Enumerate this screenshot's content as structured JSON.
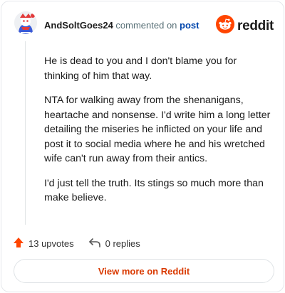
{
  "comment": {
    "author": "AndSoltGoes24",
    "verb": "commented on",
    "post_link": "post",
    "paragraphs": [
      "He is dead to you and I don't blame you for thinking of him that way.",
      "NTA for walking away from the shenanigans, heartache and nonsense. I'd write him a long letter detailing the miseries he inflicted on your life and post it to social media where he and his wretched wife can't run away from their antics.",
      "I'd just tell the truth. Its stings so much more than make believe."
    ]
  },
  "brand": {
    "name": "reddit",
    "icon": "reddit-logo-icon",
    "color": "#ff4500"
  },
  "footer": {
    "upvotes": "13 upvotes",
    "replies": "0 replies",
    "view_more": "View more on Reddit"
  },
  "colors": {
    "accent": "#d93900",
    "upvote": "#ff4500",
    "link": "#0045ac"
  }
}
